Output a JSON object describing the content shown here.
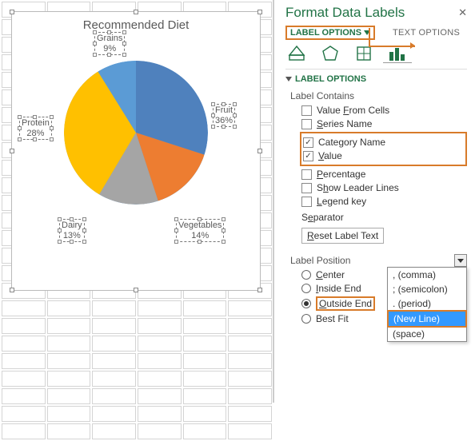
{
  "panel": {
    "title": "Format Data Labels",
    "label_options_tab": "LABEL OPTIONS",
    "text_options_tab": "TEXT OPTIONS",
    "section_head": "LABEL OPTIONS",
    "label_contains": "Label Contains",
    "opts": {
      "value_from_cells": "Value From Cells",
      "series_name": "Series Name",
      "category_name": "Category Name",
      "value": "Value",
      "percentage": "Percentage",
      "show_leader_lines": "Show Leader Lines",
      "legend_key": "Legend key"
    },
    "separator_label": "Separator",
    "reset_label": "Reset Label Text",
    "label_position": "Label Position",
    "pos": {
      "center": "Center",
      "inside_end": "Inside End",
      "outside_end": "Outside End",
      "best_fit": "Best Fit"
    },
    "dropdown": {
      "comma": ", (comma)",
      "semicolon": "; (semicolon)",
      "period": ". (period)",
      "newline": "(New Line)",
      "space": "  (space)"
    }
  },
  "chart": {
    "title": "Recommended Diet",
    "labels": {
      "fruit": "Fruit",
      "fruit_v": "36%",
      "veg": "Vegetables",
      "veg_v": "14%",
      "dairy": "Dairy",
      "dairy_v": "13%",
      "protein": "Protein",
      "protein_v": "28%",
      "grains": "Grains",
      "grains_v": "9%"
    }
  },
  "chart_data": {
    "type": "pie",
    "title": "Recommended Diet",
    "categories": [
      "Fruit",
      "Vegetables",
      "Dairy",
      "Protein",
      "Grains"
    ],
    "values": [
      36,
      14,
      13,
      28,
      9
    ],
    "colors": [
      "#4f81bd",
      "#ed7d31",
      "#a5a5a5",
      "#ffc000",
      "#5b9bd5"
    ],
    "data_labels": {
      "show_category": true,
      "show_value": true,
      "position": "Outside End",
      "separator": "(New Line)"
    }
  }
}
